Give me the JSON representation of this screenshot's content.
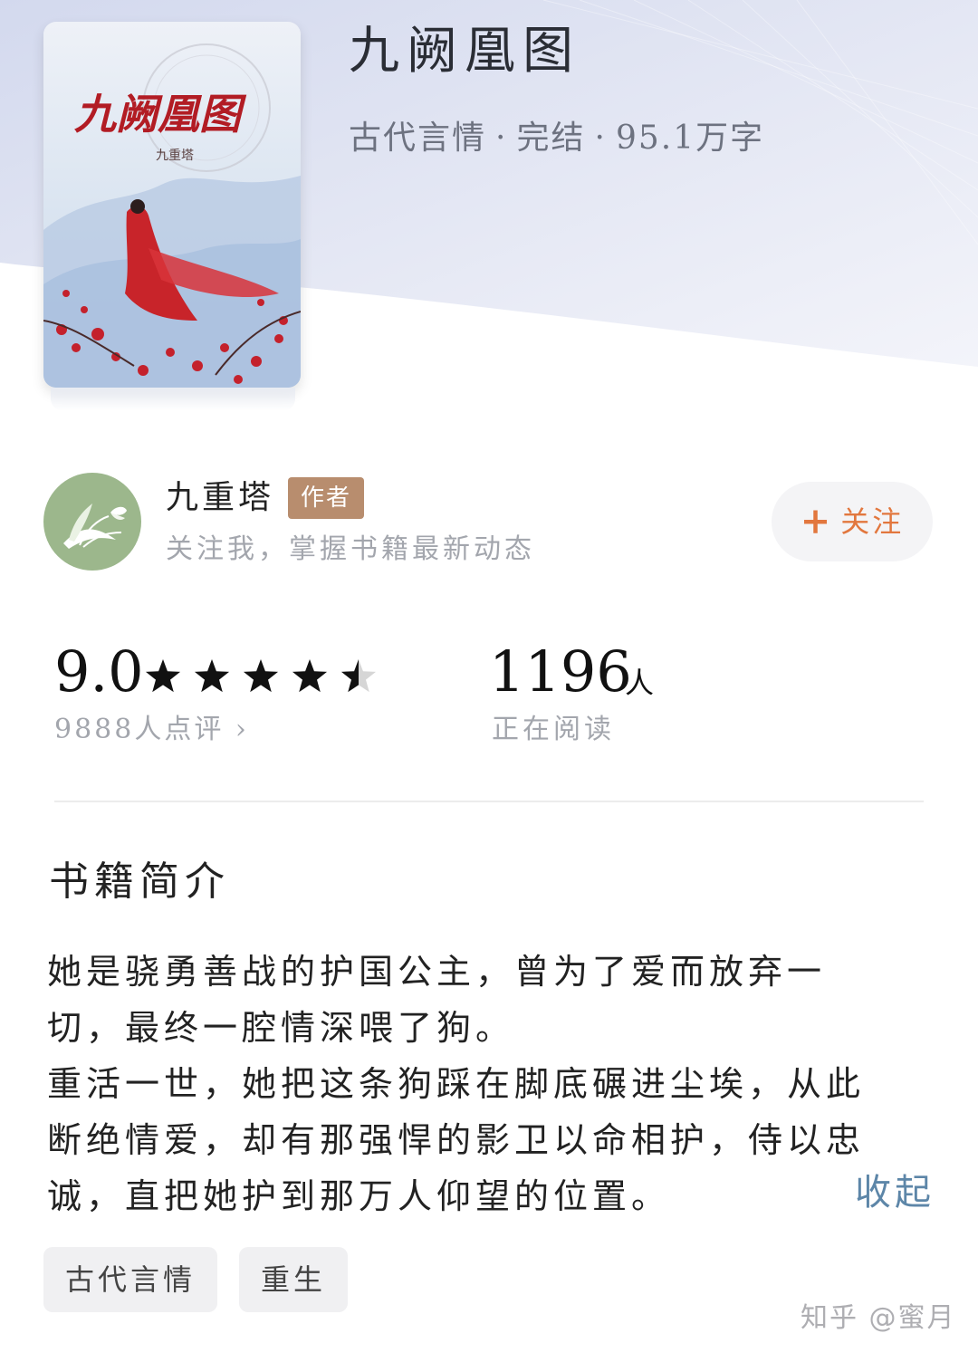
{
  "book": {
    "title": "九阙凰图",
    "genre": "古代言情",
    "status": "完结",
    "word_count": "95.1万字",
    "separator": "·",
    "cover_title_art": "九阙凰图",
    "cover_author_art": "九重塔"
  },
  "author": {
    "name": "九重塔",
    "badge": "作者",
    "description": "关注我，掌握书籍最新动态",
    "follow_label": "关注",
    "follow_icon": "plus-icon",
    "avatar_icon": "book-butterfly-avatar"
  },
  "rating": {
    "score": "9.0",
    "stars": 4.5,
    "stars_max": 5,
    "reviews_label": "9888人点评 ›"
  },
  "readers": {
    "count": "1196",
    "unit": "人",
    "label": "正在阅读"
  },
  "synopsis": {
    "title": "书籍简介",
    "lines": [
      "她是骁勇善战的护国公主，曾为了爱而放弃一",
      "切，最终一腔情深喂了狗。",
      "重活一世，她把这条狗踩在脚底碾进尘埃，从此",
      "断绝情爱，却有那强悍的影卫以命相护，侍以忠",
      "诚，直把她护到那万人仰望的位置。"
    ],
    "collapse_label": "收起"
  },
  "tags": [
    "古代言情",
    "重生"
  ],
  "watermark": "知乎 @蜜月",
  "colors": {
    "accent_orange": "#e2773e",
    "link_blue": "#5d86a8",
    "badge_brown": "#b88d6e",
    "muted_gray": "#a3a6ad",
    "avatar_green": "#9cb78c"
  }
}
